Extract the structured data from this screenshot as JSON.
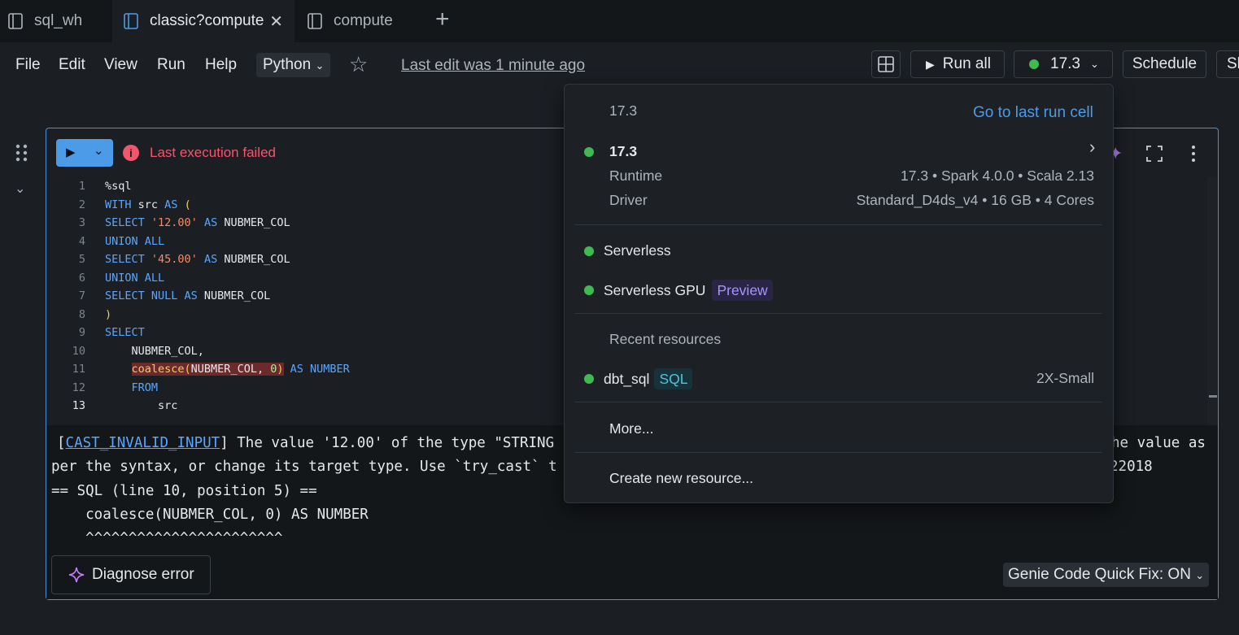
{
  "tabs": [
    {
      "label": "sql_wh",
      "icon": "notebook-icon",
      "active": false
    },
    {
      "label": "classic?compute",
      "icon": "notebook-icon",
      "active": true
    },
    {
      "label": "compute",
      "icon": "notebook-icon",
      "active": false
    }
  ],
  "menu": {
    "file": "File",
    "edit": "Edit",
    "view": "View",
    "run": "Run",
    "help": "Help",
    "language": "Python",
    "last_edit": "Last edit was 1 minute ago"
  },
  "toolbar": {
    "run_all": "Run all",
    "compute": "17.3",
    "schedule": "Schedule",
    "share_partial": "Sh"
  },
  "cell": {
    "status": "Last execution failed",
    "code_lines": [
      "1",
      "2",
      "3",
      "4",
      "5",
      "6",
      "7",
      "8",
      "9",
      "10",
      "11",
      "12",
      "13"
    ],
    "output": {
      "error_code": "CAST_INVALID_INPUT",
      "line1_rest": "] The value '12.00' of the type \"STRING",
      "line1_end": "he value as",
      "line2": "per the syntax, or change its target type. Use `try_cast` t",
      "line2_end": "22018",
      "line3": "== SQL (line 10, position 5) ==",
      "line4": "    coalesce(NUBMER_COL, 0) AS NUMBER",
      "line5": "    ^^^^^^^^^^^^^^^^^^^^^^^"
    },
    "diagnose": "Diagnose error",
    "genie": "Genie Code Quick Fix: ON"
  },
  "dropdown": {
    "header_version": "17.3",
    "go_to_last": "Go to last run cell",
    "cluster_name": "17.3",
    "runtime_label": "Runtime",
    "runtime_value": "17.3 • Spark 4.0.0 • Scala 2.13",
    "driver_label": "Driver",
    "driver_value": "Standard_D4ds_v4 • 16 GB • 4 Cores",
    "serverless": "Serverless",
    "serverless_gpu": "Serverless GPU",
    "preview_badge": "Preview",
    "recent_resources": "Recent resources",
    "dbt_sql": "dbt_sql",
    "sql_badge": "SQL",
    "dbt_size": "2X-Small",
    "more": "More...",
    "create_new": "Create new resource..."
  },
  "colors": {
    "accent": "#4c9be8",
    "error": "#f2566d",
    "status_green": "#3fb950"
  }
}
